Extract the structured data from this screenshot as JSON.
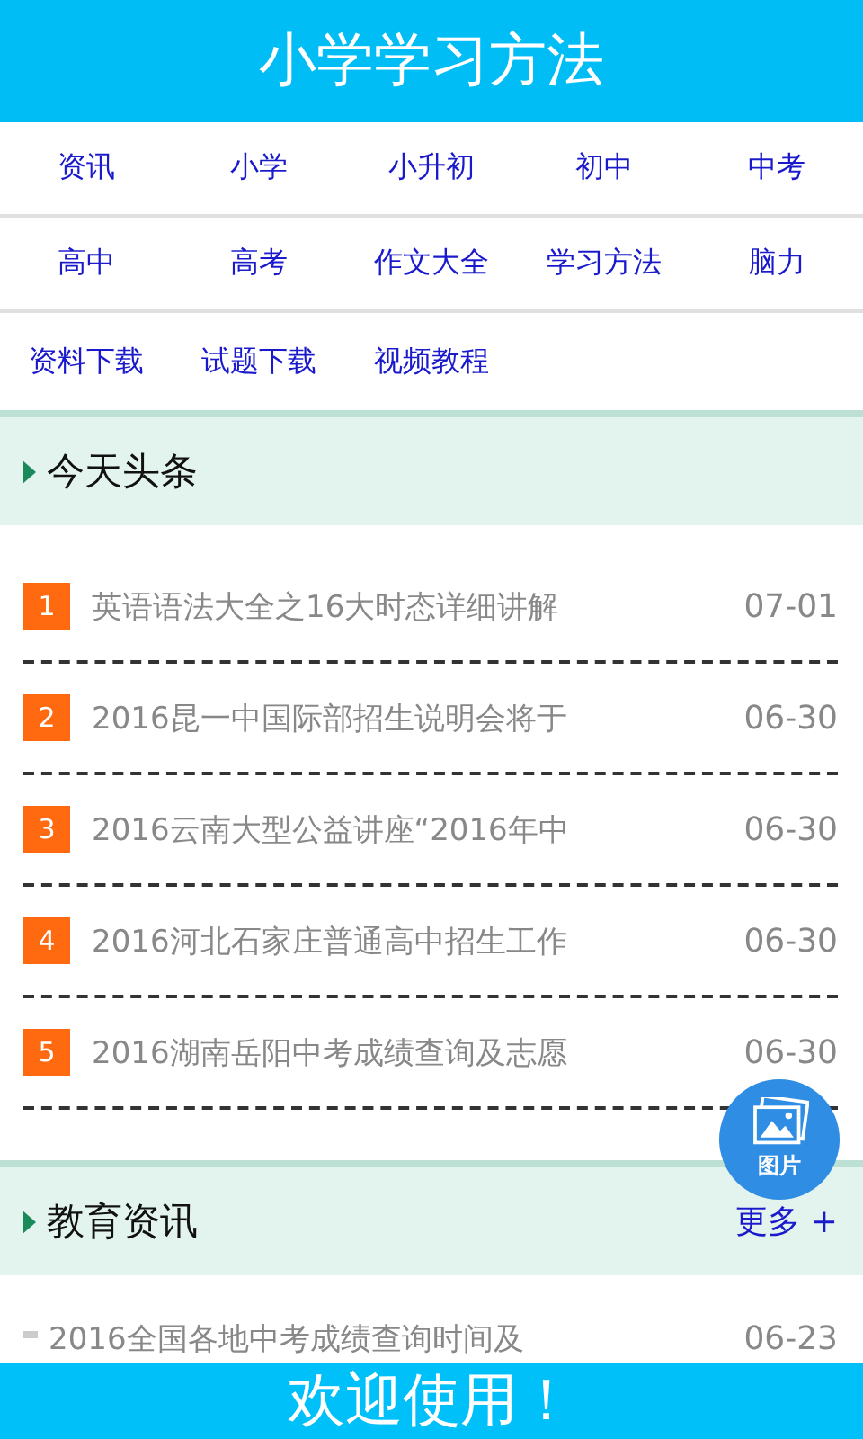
{
  "header": {
    "title": "小学学习方法"
  },
  "nav": [
    {
      "label": "资讯"
    },
    {
      "label": "小学"
    },
    {
      "label": "小升初"
    },
    {
      "label": "初中"
    },
    {
      "label": "中考"
    },
    {
      "label": "高中"
    },
    {
      "label": "高考"
    },
    {
      "label": "作文大全"
    },
    {
      "label": "学习方法"
    },
    {
      "label": "脑力"
    },
    {
      "label": "资料下载"
    },
    {
      "label": "试题下载"
    },
    {
      "label": "视频教程"
    }
  ],
  "sections": [
    {
      "title": "今天头条",
      "items": [
        {
          "rank": "1",
          "title": "英语语法大全之16大时态详细讲解",
          "date": "07-01"
        },
        {
          "rank": "2",
          "title": "2016昆一中国际部招生说明会将于",
          "date": "06-30"
        },
        {
          "rank": "3",
          "title": "2016云南大型公益讲座“2016年中",
          "date": "06-30"
        },
        {
          "rank": "4",
          "title": "2016河北石家庄普通高中招生工作",
          "date": "06-30"
        },
        {
          "rank": "5",
          "title": "2016湖南岳阳中考成绩查询及志愿",
          "date": "06-30"
        }
      ]
    },
    {
      "title": "教育资讯",
      "more": "更多 +",
      "items": [
        {
          "title": "2016全国各地中考成绩查询时间及",
          "date": "06-23"
        }
      ]
    }
  ],
  "fab": {
    "label": "图片"
  },
  "banner": {
    "text": "欢迎使用！"
  }
}
